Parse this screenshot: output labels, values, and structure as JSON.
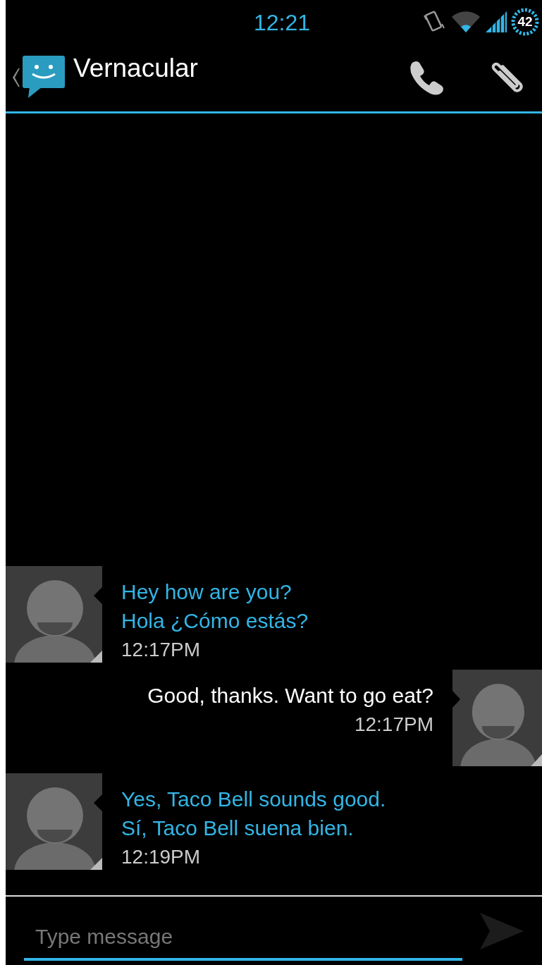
{
  "status_bar": {
    "time": "12:21",
    "battery": "42"
  },
  "header": {
    "title": "Vernacular"
  },
  "messages": [
    {
      "kind": "incoming",
      "lines": [
        "Hey how are you?",
        "Hola ¿Cómo estás?"
      ],
      "time": "12:17PM"
    },
    {
      "kind": "outgoing",
      "lines": [
        "Good, thanks. Want to go eat?"
      ],
      "time": "12:17PM"
    },
    {
      "kind": "incoming",
      "lines": [
        "Yes, Taco Bell sounds good.",
        "Sí, Taco Bell suena bien."
      ],
      "time": "12:19PM"
    }
  ],
  "composer": {
    "placeholder": "Type message"
  }
}
